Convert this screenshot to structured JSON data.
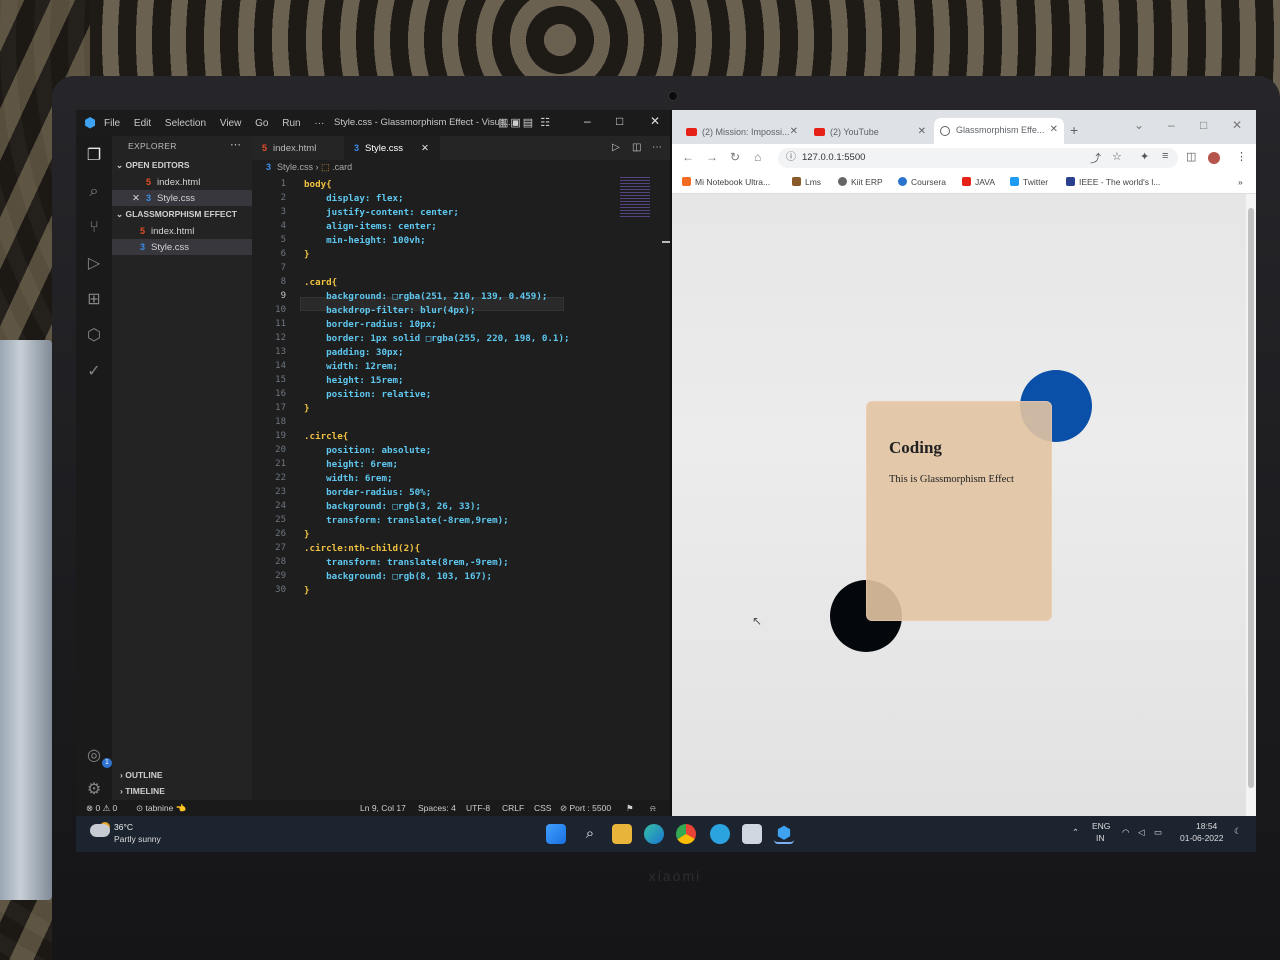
{
  "vscode": {
    "window_title": "Style.css - Glassmorphism Effect - Visua...",
    "menu": [
      "File",
      "Edit",
      "Selection",
      "View",
      "Go",
      "Run",
      "···"
    ],
    "explorer_title": "EXPLORER",
    "open_editors_label": "OPEN EDITORS",
    "open_editors": [
      "index.html",
      "Style.css"
    ],
    "project_label": "GLASSMORPHISM EFFECT",
    "project_files": [
      "index.html",
      "Style.css"
    ],
    "outline_label": "OUTLINE",
    "timeline_label": "TIMELINE",
    "tabs": [
      "index.html",
      "Style.css"
    ],
    "breadcrumb": [
      "Style.css",
      ".card"
    ],
    "code_lines": [
      "body{",
      "    display: flex;",
      "    justify-content: center;",
      "    align-items: center;",
      "    min-height: 100vh;",
      "}",
      "",
      ".card{",
      "    background: □rgba(251, 210, 139, 0.459);",
      "    backdrop-filter: blur(4px);",
      "    border-radius: 10px;",
      "    border: 1px solid □rgba(255, 220, 198, 0.1);",
      "    padding: 30px;",
      "    width: 12rem;",
      "    height: 15rem;",
      "    position: relative;",
      "}",
      "",
      ".circle{",
      "    position: absolute;",
      "    height: 6rem;",
      "    width: 6rem;",
      "    border-radius: 50%;",
      "    background: □rgb(3, 26, 33);",
      "    transform: translate(-8rem,9rem);",
      "}",
      ".circle:nth-child(2){",
      "    transform: translate(8rem,-9rem);",
      "    background: □rgb(8, 103, 167);",
      "}"
    ],
    "line_numbers": [
      "1",
      "2",
      "3",
      "4",
      "5",
      "6",
      "7",
      "8",
      "9",
      "10",
      "11",
      "12",
      "13",
      "14",
      "15",
      "16",
      "17",
      "18",
      "19",
      "20",
      "21",
      "22",
      "23",
      "24",
      "25",
      "26",
      "27",
      "28",
      "29",
      "30"
    ],
    "status": {
      "problems": "⊗ 0 ⚠ 0",
      "tabnine": "⊙ tabnine 👈",
      "position": "Ln 9, Col 17",
      "spaces": "Spaces: 4",
      "encoding": "UTF-8",
      "eol": "CRLF",
      "language": "CSS",
      "port": "⊘ Port : 5500"
    }
  },
  "chrome": {
    "tabs": [
      "(2) Mission: Impossi...",
      "(2) YouTube",
      "Glassmorphism Effe..."
    ],
    "url": "127.0.0.1:5500",
    "bookmarks": [
      "Mi Notebook Ultra...",
      "Lms",
      "Kiit ERP",
      "Coursera",
      "JAVA",
      "Twitter",
      "IEEE - The world's l..."
    ],
    "card_title": "Coding",
    "card_text": "This is Glassmorphism Effect"
  },
  "taskbar": {
    "temperature": "36°C",
    "weather": "Partly sunny",
    "lang": "ENG",
    "region": "IN",
    "time": "18:54",
    "date": "01-06-2022"
  },
  "colors": {
    "card_bg": "#e2c4a2",
    "circle_blue": "#0a4fa8",
    "circle_dark": "#04080d",
    "vscode_bg": "#1e1e1e",
    "css_selector": "#f0c240",
    "css_property": "#5ec8f0",
    "css_value": "#ff5ca8"
  }
}
